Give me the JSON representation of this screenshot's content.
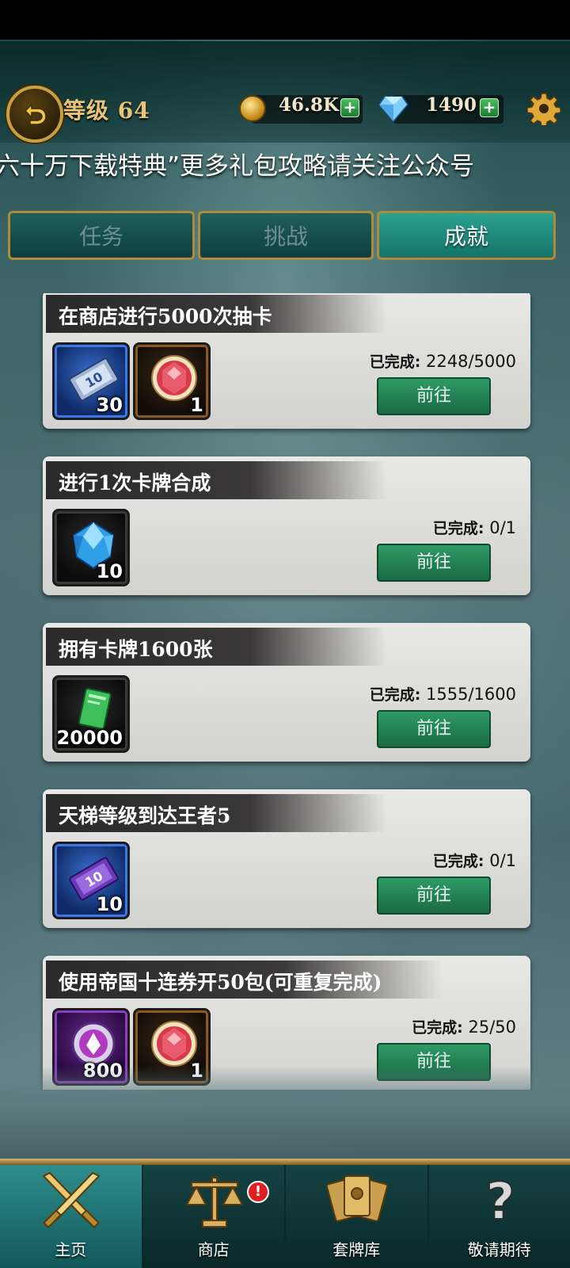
{
  "header": {
    "level_label": "等级 64",
    "gold_amount": "46.8K",
    "diamond_amount": "1490"
  },
  "marquee": "六十万下载特典”更多礼包攻略请关注公众号",
  "tabs": [
    {
      "label": "任务",
      "active": false
    },
    {
      "label": "挑战",
      "active": false
    },
    {
      "label": "成就",
      "active": true
    }
  ],
  "tasks": [
    {
      "title": "在商店进行5000次抽卡",
      "progress_label": "已完成:",
      "progress": "2248/5000",
      "button": "前往",
      "rewards": [
        {
          "icon": "ticket-10-icon",
          "count": "30"
        },
        {
          "icon": "ruby-icon",
          "count": "1"
        }
      ]
    },
    {
      "title": "进行1次卡牌合成",
      "progress_label": "已完成:",
      "progress": "0/1",
      "button": "前往",
      "rewards": [
        {
          "icon": "blue-crystal-icon",
          "count": "10"
        }
      ]
    },
    {
      "title": "拥有卡牌1600张",
      "progress_label": "已完成:",
      "progress": "1555/1600",
      "button": "前往",
      "rewards": [
        {
          "icon": "green-card-icon",
          "count": "20000"
        }
      ]
    },
    {
      "title": "天梯等级到达王者5",
      "progress_label": "已完成:",
      "progress": "0/1",
      "button": "前往",
      "rewards": [
        {
          "icon": "purple-ticket-icon",
          "count": "10"
        }
      ]
    },
    {
      "title": "使用帝国十连券开50包(可重复完成)",
      "progress_label": "已完成:",
      "progress": "25/50",
      "button": "前往",
      "rewards": [
        {
          "icon": "purple-token-icon",
          "count": "800"
        },
        {
          "icon": "ruby-icon",
          "count": "1"
        }
      ]
    }
  ],
  "nav": [
    {
      "label": "主页",
      "icon": "crossed-swords-icon",
      "active": true
    },
    {
      "label": "商店",
      "icon": "scales-icon",
      "active": false,
      "badge": "!"
    },
    {
      "label": "套牌库",
      "icon": "card-deck-icon",
      "active": false
    },
    {
      "label": "敬请期待",
      "icon": "question-mark-icon",
      "active": false
    }
  ]
}
